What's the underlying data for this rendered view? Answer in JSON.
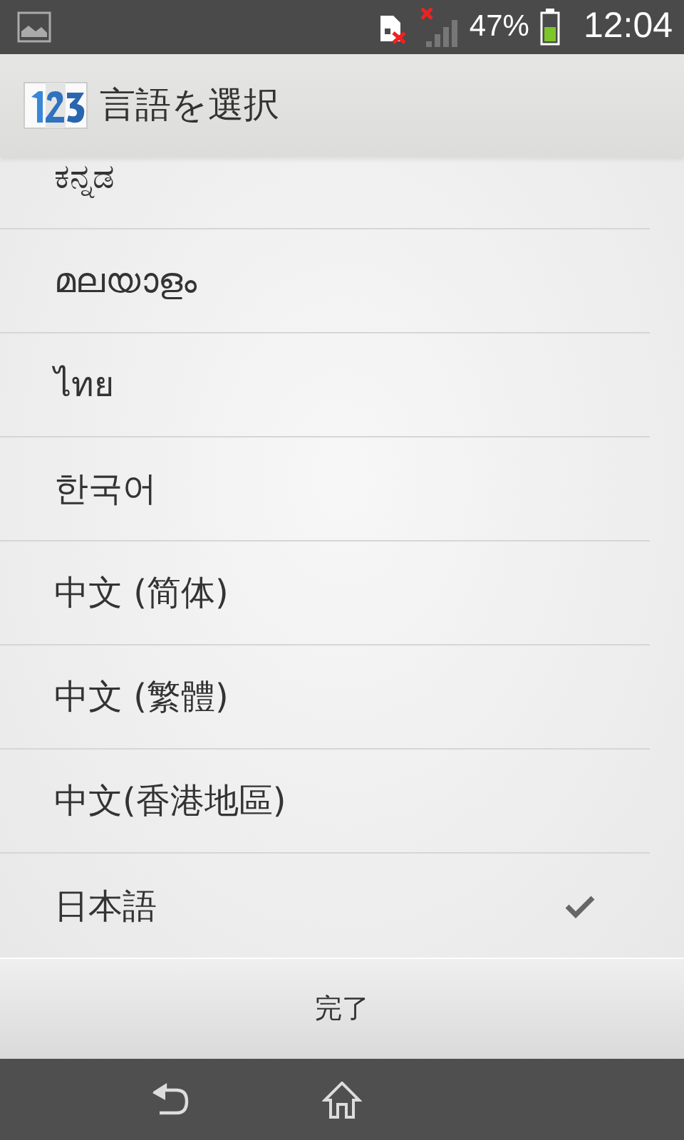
{
  "status_bar": {
    "battery": "47%",
    "time": "12:04"
  },
  "dialog": {
    "title": "言語を選択",
    "languages": [
      {
        "label": "ಕನ್ನಡ",
        "selected": false
      },
      {
        "label": "മലയാളം",
        "selected": false
      },
      {
        "label": "ไทย",
        "selected": false
      },
      {
        "label": "한국어",
        "selected": false
      },
      {
        "label": "中文 (简体)",
        "selected": false
      },
      {
        "label": "中文 (繁體)",
        "selected": false
      },
      {
        "label": "中文(香港地區)",
        "selected": false
      },
      {
        "label": "日本語",
        "selected": true
      }
    ],
    "done_button": "完了"
  }
}
